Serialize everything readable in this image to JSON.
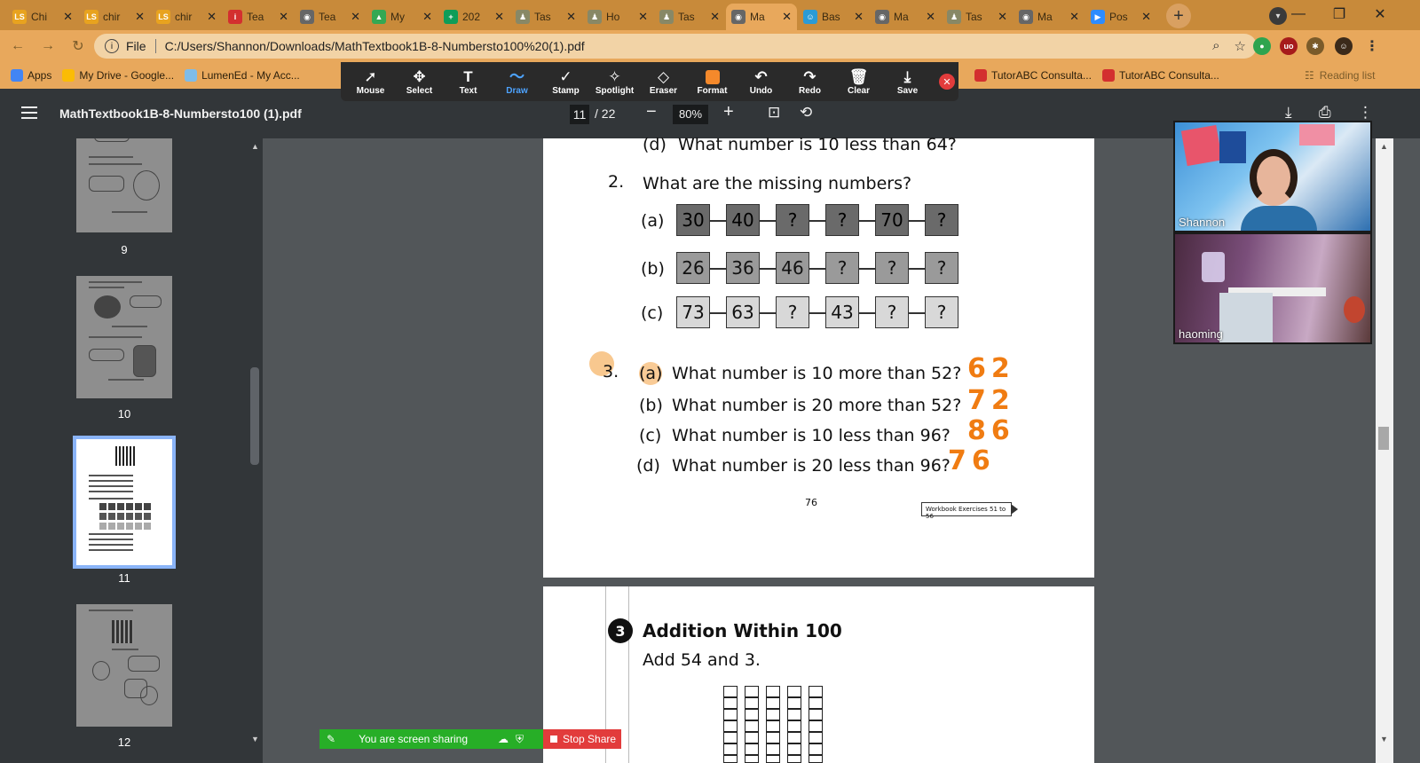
{
  "tabs": [
    {
      "label": "Chi",
      "color": "#e8a31f",
      "glyph": "LS",
      "active": false
    },
    {
      "label": "chir",
      "color": "#e8a31f",
      "glyph": "LS",
      "active": false
    },
    {
      "label": "chir",
      "color": "#e8a31f",
      "glyph": "LS",
      "active": false
    },
    {
      "label": "Tea",
      "color": "#d32f2f",
      "glyph": "i",
      "active": false
    },
    {
      "label": "Tea",
      "color": "#666666",
      "glyph": "◉",
      "active": false
    },
    {
      "label": "My",
      "color": "#34a853",
      "glyph": "▲",
      "active": false
    },
    {
      "label": "202",
      "color": "#0f9d58",
      "glyph": "+",
      "active": false
    },
    {
      "label": "Tas",
      "color": "#888866",
      "glyph": "♟",
      "active": false
    },
    {
      "label": "Ho",
      "color": "#888866",
      "glyph": "♟",
      "active": false
    },
    {
      "label": "Tas",
      "color": "#888866",
      "glyph": "♟",
      "active": false
    },
    {
      "label": "Ma",
      "color": "#666666",
      "glyph": "◉",
      "active": true
    },
    {
      "label": "Bas",
      "color": "#2b9bd6",
      "glyph": "☺",
      "active": false
    },
    {
      "label": "Ma",
      "color": "#666666",
      "glyph": "◉",
      "active": false
    },
    {
      "label": "Tas",
      "color": "#888866",
      "glyph": "♟",
      "active": false
    },
    {
      "label": "Ma",
      "color": "#666666",
      "glyph": "◉",
      "active": false
    },
    {
      "label": "Pos",
      "color": "#2d8cff",
      "glyph": "▶",
      "active": false
    }
  ],
  "address": {
    "scheme": "File",
    "url": "C:/Users/Shannon/Downloads/MathTextbook1B-8-Numbersto100%20(1).pdf"
  },
  "bookmarks": [
    {
      "label": "Apps",
      "color": "#4285f4"
    },
    {
      "label": "My Drive - Google...",
      "color": "#fbbc05"
    },
    {
      "label": "LumenEd - My Acc...",
      "color": "#7fbce8"
    }
  ],
  "bookmarks_right": [
    {
      "label": "TutorABC Consulta...",
      "color": "#d32f2f"
    },
    {
      "label": "TutorABC Consulta...",
      "color": "#d32f2f"
    }
  ],
  "reading_list": "Reading list",
  "annotation_tools": [
    {
      "label": "Mouse",
      "icon": "➚"
    },
    {
      "label": "Select",
      "icon": "✥"
    },
    {
      "label": "Text",
      "icon": "T"
    },
    {
      "label": "Draw",
      "icon": "〜"
    },
    {
      "label": "Stamp",
      "icon": "✓"
    },
    {
      "label": "Spotlight",
      "icon": "✧"
    },
    {
      "label": "Eraser",
      "icon": "◇"
    },
    {
      "label": "Format",
      "icon": ""
    },
    {
      "label": "Undo",
      "icon": "↶"
    },
    {
      "label": "Redo",
      "icon": "↷"
    },
    {
      "label": "Clear",
      "icon": "🗑"
    },
    {
      "label": "Save",
      "icon": "⤓"
    }
  ],
  "annotation_selected": "Draw",
  "pdf": {
    "title": "MathTextbook1B-8-Numbersto100 (1).pdf",
    "page": "11",
    "total": "/ 22",
    "zoom": "80%"
  },
  "thumbnails": [
    {
      "num": "9"
    },
    {
      "num": "10"
    },
    {
      "num": "11"
    },
    {
      "num": "12"
    }
  ],
  "page_content": {
    "q1d_label": "(d)",
    "q1d_text": "What number is 10 less than 64?",
    "q2_num": "2.",
    "q2_text": "What are the missing numbers?",
    "rows": [
      {
        "label": "(a)",
        "cells": [
          "30",
          "40",
          "?",
          "?",
          "70",
          "?"
        ]
      },
      {
        "label": "(b)",
        "cells": [
          "26",
          "36",
          "46",
          "?",
          "?",
          "?"
        ]
      },
      {
        "label": "(c)",
        "cells": [
          "73",
          "63",
          "?",
          "43",
          "?",
          "?"
        ]
      }
    ],
    "q3_num": "3.",
    "q3_items": [
      {
        "label": "(a)",
        "text": "What number is 10 more than 52?",
        "answer": "62"
      },
      {
        "label": "(b)",
        "text": "What number is 20 more than 52?",
        "answer": "72"
      },
      {
        "label": "(c)",
        "text": "What number is 10 less than 96?",
        "answer": "86"
      },
      {
        "label": "(d)",
        "text": "What number is 20 less than 96?",
        "answer": "76"
      }
    ],
    "page_number": "76",
    "workbook": "Workbook Exercises 51 to 56",
    "next_section_num": "3",
    "next_section_title": "Addition Within 100",
    "next_section_sub": "Add 54 and 3."
  },
  "videos": [
    {
      "name": "Shannon"
    },
    {
      "name": "haoming"
    }
  ],
  "share": {
    "status": "You are screen sharing",
    "stop": "Stop Share"
  }
}
